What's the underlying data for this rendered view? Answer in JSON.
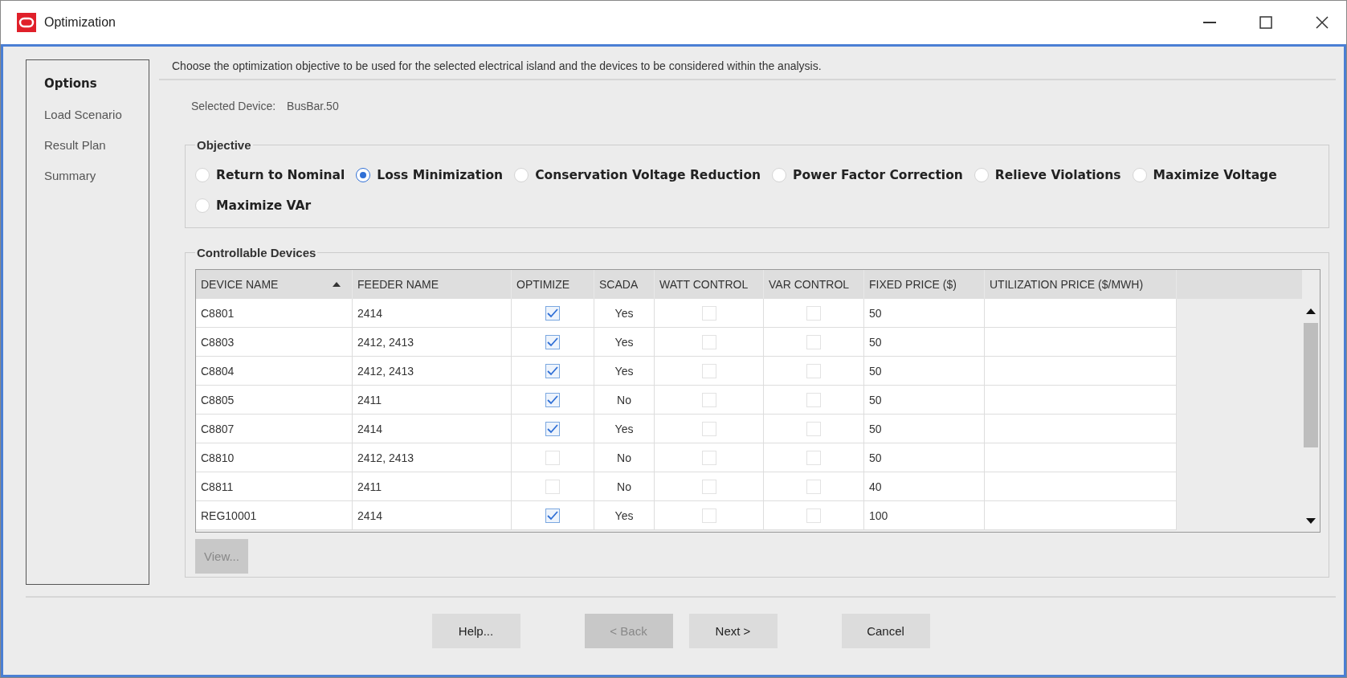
{
  "window": {
    "title": "Optimization"
  },
  "nav": [
    {
      "label": "Options",
      "selected": true
    },
    {
      "label": "Load Scenario",
      "selected": false
    },
    {
      "label": "Result Plan",
      "selected": false
    },
    {
      "label": "Summary",
      "selected": false
    }
  ],
  "description": "Choose the optimization objective to be used for the selected electrical island and the devices to be considered within the analysis.",
  "selected_device": {
    "label": "Selected Device:",
    "value": "BusBar.50"
  },
  "objective": {
    "title": "Objective",
    "options": [
      {
        "label": "Return to Nominal",
        "selected": false
      },
      {
        "label": "Loss Minimization",
        "selected": true
      },
      {
        "label": "Conservation Voltage Reduction",
        "selected": false
      },
      {
        "label": "Power Factor Correction",
        "selected": false
      },
      {
        "label": "Relieve Violations",
        "selected": false
      },
      {
        "label": "Maximize Voltage",
        "selected": false
      },
      {
        "label": "Maximize VAr",
        "selected": false
      }
    ]
  },
  "devices": {
    "title": "Controllable Devices",
    "columns": [
      "DEVICE NAME",
      "FEEDER NAME",
      "OPTIMIZE",
      "SCADA",
      "WATT CONTROL",
      "VAR CONTROL",
      "FIXED PRICE ($)",
      "UTILIZATION PRICE ($/MWH)"
    ],
    "rows": [
      {
        "device": "C8801",
        "feeder": "2414",
        "optimize": true,
        "scada": "Yes",
        "watt_control": false,
        "var_control": false,
        "fixed_price": "50"
      },
      {
        "device": "C8803",
        "feeder": "2412, 2413",
        "optimize": true,
        "scada": "Yes",
        "watt_control": false,
        "var_control": false,
        "fixed_price": "50"
      },
      {
        "device": "C8804",
        "feeder": "2412, 2413",
        "optimize": true,
        "scada": "Yes",
        "watt_control": false,
        "var_control": false,
        "fixed_price": "50"
      },
      {
        "device": "C8805",
        "feeder": "2411",
        "optimize": true,
        "scada": "No",
        "watt_control": false,
        "var_control": false,
        "fixed_price": "50"
      },
      {
        "device": "C8807",
        "feeder": "2414",
        "optimize": true,
        "scada": "Yes",
        "watt_control": false,
        "var_control": false,
        "fixed_price": "50"
      },
      {
        "device": "C8810",
        "feeder": "2412, 2413",
        "optimize": false,
        "scada": "No",
        "watt_control": false,
        "var_control": false,
        "fixed_price": "50"
      },
      {
        "device": "C8811",
        "feeder": "2411",
        "optimize": false,
        "scada": "No",
        "watt_control": false,
        "var_control": false,
        "fixed_price": "40"
      },
      {
        "device": "REG10001",
        "feeder": "2414",
        "optimize": true,
        "scada": "Yes",
        "watt_control": false,
        "var_control": false,
        "fixed_price": "100"
      }
    ],
    "view_button": {
      "label": "View...",
      "disabled": true
    }
  },
  "buttons": [
    {
      "label": "Help...",
      "disabled": false
    },
    {
      "label": "< Back",
      "disabled": true
    },
    {
      "label": "Next >",
      "disabled": false
    },
    {
      "label": "Cancel",
      "disabled": false
    }
  ]
}
